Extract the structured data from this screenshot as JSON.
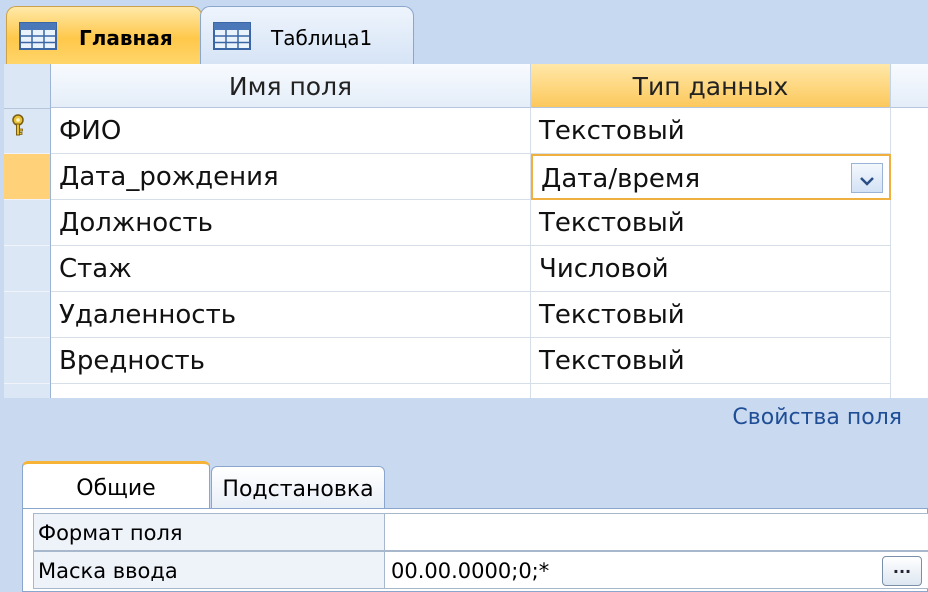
{
  "doc_tabs": [
    {
      "label": "Главная",
      "icon": "table-icon",
      "active": true
    },
    {
      "label": "Таблица1",
      "icon": "table-icon",
      "active": false
    }
  ],
  "grid": {
    "headers": {
      "field_name": "Имя поля",
      "data_type": "Тип данных"
    },
    "rows": [
      {
        "name": "ФИО",
        "type": "Текстовый",
        "primary_key": true
      },
      {
        "name": "Дата_рождения",
        "type": "Дата/время",
        "current": true
      },
      {
        "name": "Должность",
        "type": "Текстовый"
      },
      {
        "name": "Стаж",
        "type": "Числовой"
      },
      {
        "name": "Удаленность",
        "type": "Текстовый"
      },
      {
        "name": "Вредность",
        "type": "Текстовый"
      }
    ]
  },
  "properties": {
    "title": "Свойства поля",
    "tabs": [
      "Общие",
      "Подстановка"
    ],
    "active_tab": "Общие",
    "rows": [
      {
        "label": "Формат поля",
        "value": ""
      },
      {
        "label": "Маска ввода",
        "value": "00.00.0000;0;*"
      }
    ],
    "build_button": "..."
  },
  "colors": {
    "accent": "#fcc85c",
    "panel": "#c9daf0",
    "link": "#1f4e96"
  }
}
